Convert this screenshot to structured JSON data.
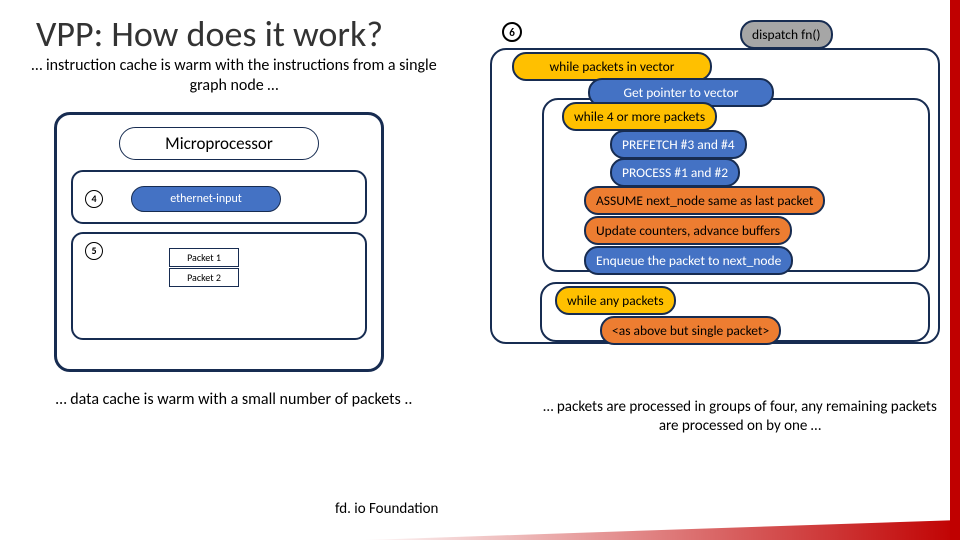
{
  "title": "VPP: How does it work?",
  "step_icon": "6",
  "left_text_top": "… instruction cache is warm with the instructions from a single graph node …",
  "left_text_bottom": "… data cache is warm with a small number of packets ..",
  "micro": {
    "title": "Microprocessor",
    "box1_num": "4",
    "box1_label": "ethernet-input",
    "box2_num": "5",
    "packet1": "Packet 1",
    "packet2": "Packet 2"
  },
  "right": {
    "dispatch": "dispatch fn()",
    "while_packets_vector": "while packets in vector",
    "get_pointer": "Get pointer to vector",
    "while_4": "while 4 or more packets",
    "prefetch": "PREFETCH #3 and #4",
    "process": "PROCESS #1 and #2",
    "assume": "ASSUME next_node same as last packet",
    "update": "Update counters, advance buffers",
    "enqueue": "Enqueue the packet to next_node",
    "while_any": "while any packets",
    "as_above": "<as above but single packet>"
  },
  "bottom_text": "… packets are processed in groups of four, any remaining packets are processed on by one …",
  "footer": "fd. io Foundation"
}
